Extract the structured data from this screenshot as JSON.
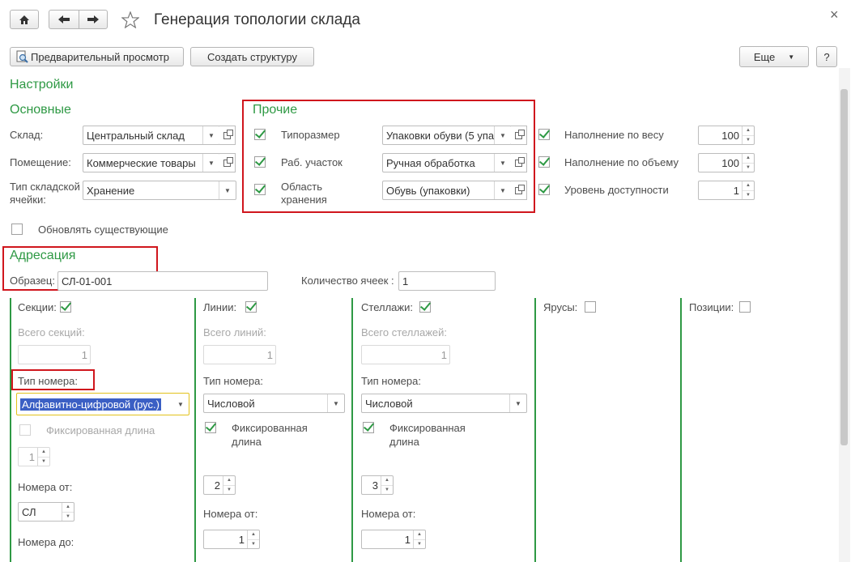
{
  "window": {
    "title": "Генерация топологии склада",
    "close_glyph": "×"
  },
  "toolbar": {
    "preview": "Предварительный просмотр",
    "create": "Создать структуру",
    "more": "Еще",
    "help": "?"
  },
  "settings": {
    "heading": "Настройки",
    "main": {
      "heading": "Основные",
      "warehouse": {
        "label": "Склад:",
        "value": "Центральный склад"
      },
      "room": {
        "label": "Помещение:",
        "value": "Коммерческие товары"
      },
      "cell_type": {
        "label1": "Тип складской",
        "label2": "ячейки:",
        "value": "Хранение"
      },
      "update_existing": {
        "label": "Обновлять существующие",
        "checked": false
      }
    },
    "other": {
      "heading": "Прочие",
      "size": {
        "label": "Типоразмер",
        "value": "Упаковки обуви (5 упа",
        "checked": true
      },
      "work_area": {
        "label": "Раб. участок",
        "value": "Ручная обработка",
        "checked": true
      },
      "storage_area": {
        "label1": "Область",
        "label2": "хранения",
        "value": "Обувь (упаковки)",
        "checked": true
      }
    },
    "fill": {
      "weight": {
        "label": "Наполнение по весу",
        "value": "100",
        "checked": true
      },
      "volume": {
        "label": "Наполнение по объему",
        "value": "100",
        "checked": true
      },
      "access": {
        "label": "Уровень доступности",
        "value": "1",
        "checked": true
      }
    }
  },
  "addressing": {
    "heading": "Адресация",
    "sample_label": "Образец:",
    "sample_value": "СЛ-01-001",
    "cells_label": "Количество ячеек :",
    "cells_value": "1",
    "sections": {
      "label": "Секции:",
      "checked": true,
      "total_label": "Всего секций:",
      "total": "1",
      "type_label": "Тип номера:",
      "type_value": "Алфавитно-цифровой (рус.)",
      "fixed_label": "Фиксированная длина",
      "fixed_checked": false,
      "fixed_value": "1",
      "from_label": "Номера от:",
      "from_value": "СЛ",
      "to_label": "Номера до:"
    },
    "lines": {
      "label": "Линии:",
      "checked": true,
      "total_label": "Всего линий:",
      "total": "1",
      "type_label": "Тип номера:",
      "type_value": "Числовой",
      "fixed_label1": "Фиксированная",
      "fixed_label2": "длина",
      "fixed_checked": true,
      "fixed_value": "2",
      "from_label": "Номера от:",
      "from_value": "1"
    },
    "racks": {
      "label": "Стеллажи:",
      "checked": true,
      "total_label": "Всего стеллажей:",
      "total": "1",
      "type_label": "Тип номера:",
      "type_value": "Числовой",
      "fixed_label1": "Фиксированная",
      "fixed_label2": "длина",
      "fixed_checked": true,
      "fixed_value": "3",
      "from_label": "Номера от:",
      "from_value": "1"
    },
    "tiers": {
      "label": "Ярусы:",
      "checked": false
    },
    "positions": {
      "label": "Позиции:",
      "checked": false
    }
  }
}
